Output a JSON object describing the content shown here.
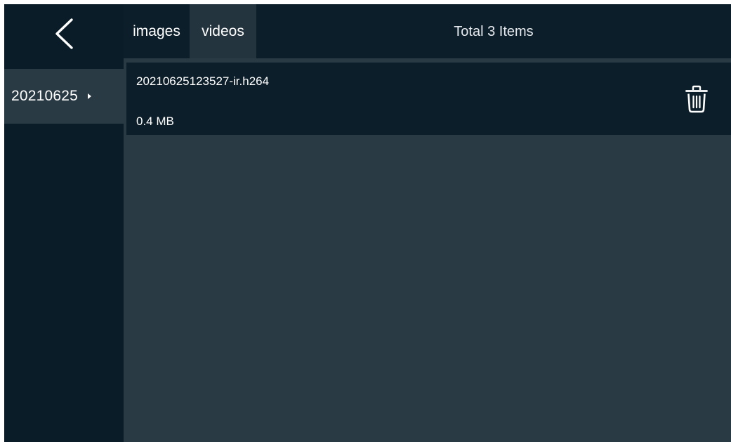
{
  "sidebar": {
    "back_icon": "chevron-left-icon",
    "items": [
      {
        "label": "20210625",
        "arrow_icon": "triangle-right-icon"
      }
    ]
  },
  "header": {
    "tabs": [
      {
        "label": "images",
        "active": false
      },
      {
        "label": "videos",
        "active": true
      }
    ],
    "total_label": "Total 3 Items"
  },
  "files": [
    {
      "name": "20210625123527-ir.h264",
      "size": "0.4 MB",
      "action_icon": "trash-icon"
    }
  ],
  "colors": {
    "header_bg": "#0c1e2a",
    "content_bg": "#293a44",
    "active_tab_bg": "#24343f",
    "selected_item_bg": "#2a3a45",
    "text": "#ffffff"
  }
}
